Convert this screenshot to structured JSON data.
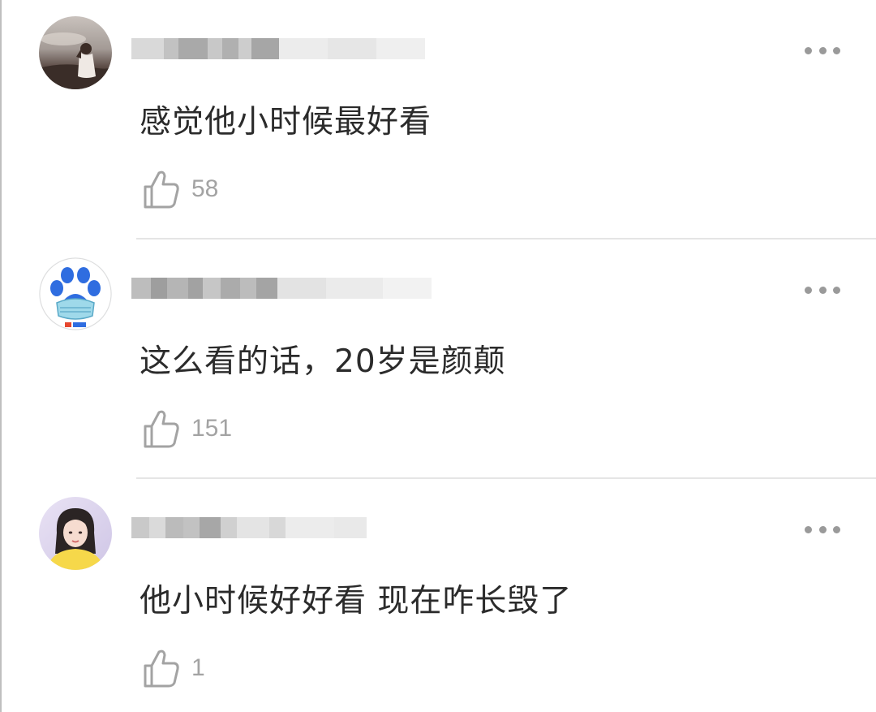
{
  "comments": [
    {
      "text": "感觉他小时候最好看",
      "likes": "58",
      "avatar_icon": "portrait-avatar-dusk",
      "username_redacted": true
    },
    {
      "text": "这么看的话，20岁是颜颠",
      "likes": "151",
      "avatar_icon": "paw-mask-avatar",
      "username_redacted": true
    },
    {
      "text": "他小时候好好看 现在咋长毁了",
      "likes": "1",
      "avatar_icon": "girl-portrait-avatar",
      "username_redacted": true
    }
  ],
  "icons": {
    "like": "thumbs-up-icon",
    "more": "more-dots-icon"
  },
  "colors": {
    "text": "#2b2b2b",
    "muted": "#a3a3a3",
    "divider": "#e5e5e5",
    "paw_blue": "#2f6de0"
  }
}
